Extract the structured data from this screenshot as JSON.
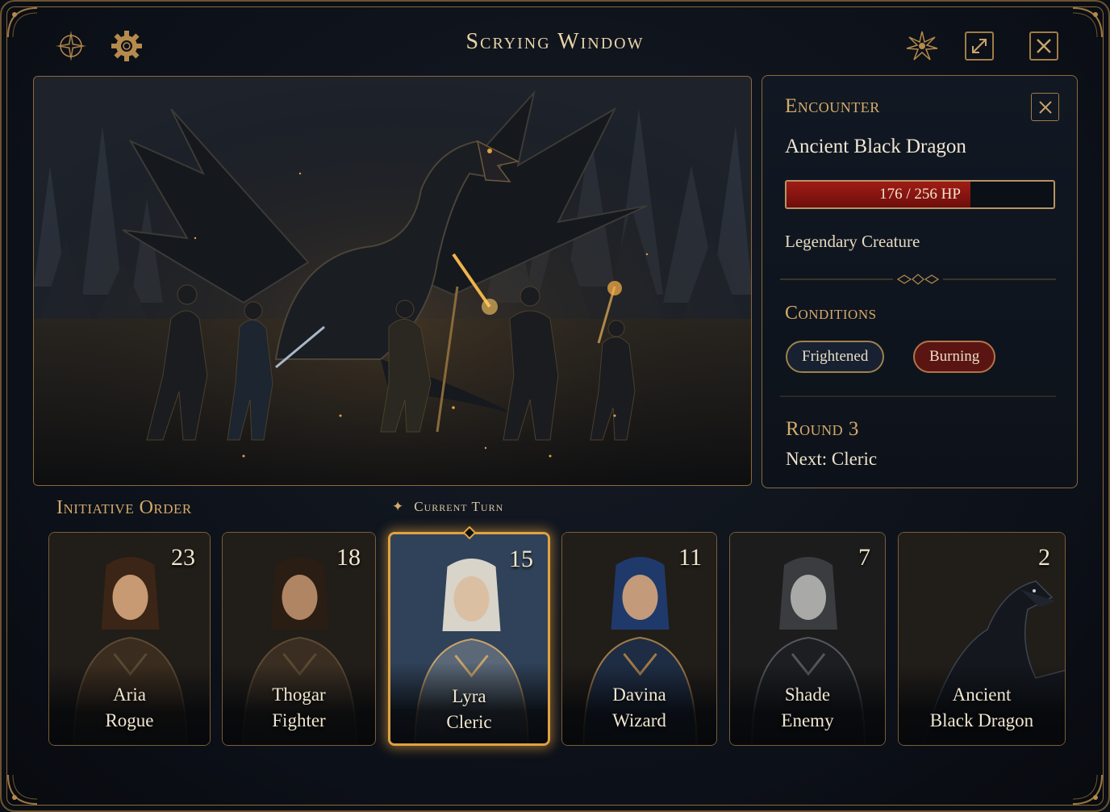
{
  "window": {
    "title": "Scrying Window",
    "left_icons": [
      "compass-rose-icon",
      "gear-icon"
    ],
    "right_icons": [
      "star-burst-icon",
      "expand-icon",
      "close-icon"
    ]
  },
  "scene": {
    "image": "dragon-battle-illustration"
  },
  "encounter": {
    "heading": "Encounter",
    "name": "Ancient Black Dragon",
    "hp_text": "176 / 256 HP",
    "hp_current": 176,
    "hp_max": 256,
    "type": "Legendary Creature",
    "conditions_heading": "Conditions",
    "conditions": [
      {
        "label": "Frightened",
        "color": "#172131"
      },
      {
        "label": "Burning",
        "color": "#5a1512"
      }
    ],
    "round": "Round 3",
    "next": "Next: Cleric"
  },
  "initiative": {
    "heading": "Initiative Order",
    "current_turn_label": "Current Turn",
    "entries": [
      {
        "name": "Aria",
        "role": "Rogue",
        "initiative": "23",
        "active": false
      },
      {
        "name": "Thogar",
        "role": "Fighter",
        "initiative": "18",
        "active": false
      },
      {
        "name": "Lyra",
        "role": "Cleric",
        "initiative": "15",
        "active": true
      },
      {
        "name": "Davina",
        "role": "Wizard",
        "initiative": "11",
        "active": false
      },
      {
        "name": "Shade",
        "role": "Enemy",
        "initiative": "7",
        "active": false
      },
      {
        "name": "Ancient",
        "role": "Black Dragon",
        "initiative": "2",
        "active": false
      }
    ]
  },
  "colors": {
    "accent_gold": "#d4aa6a",
    "hp_red": "#a01c16",
    "active_glow": "#e0a340"
  }
}
